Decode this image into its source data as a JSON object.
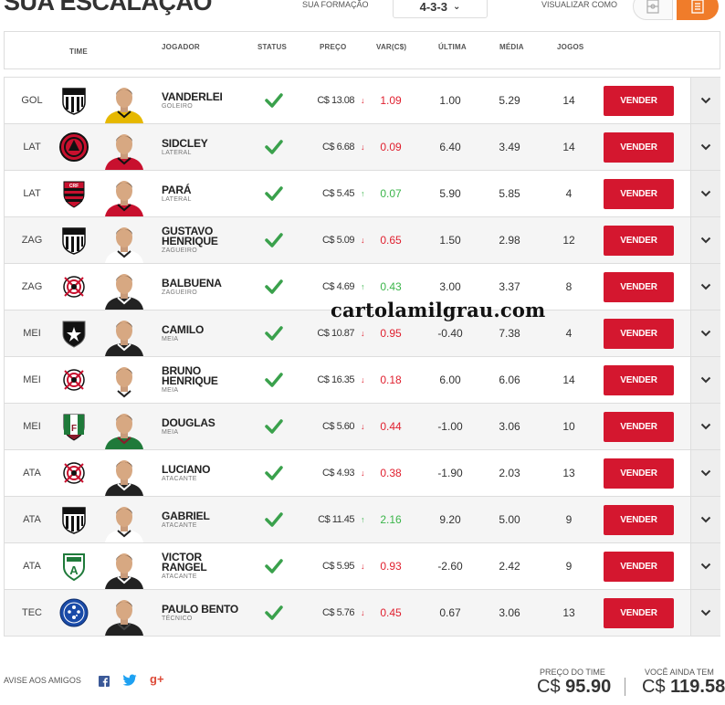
{
  "header": {
    "title": "SUA ESCALAÇÃO",
    "formation_label": "SUA FORMAÇÃO",
    "formation_value": "4-3-3",
    "view_label": "VISUALIZAR COMO"
  },
  "columns": {
    "time": "TIME",
    "jogador": "JOGADOR",
    "status": "STATUS",
    "preco": "PREÇO",
    "var": "VAR(C$)",
    "ultima": "ÚLTIMA",
    "media": "MÉDIA",
    "jogos": "JOGOS"
  },
  "colors": {
    "accent": "#f07c2a",
    "sell": "#d4172f",
    "down": "#e0202f",
    "up": "#3bb54a",
    "status_ok": "#3aa14c"
  },
  "players": [
    {
      "pos": "GOL",
      "team_icon": "santos-crest-icon",
      "name1": "VANDERLEI",
      "name2": "",
      "role": "GOLEIRO",
      "price": "C$ 13.08",
      "trend": "down",
      "var": "1.09",
      "ultima": "1.00",
      "media": "5.29",
      "jogos": "14",
      "sell": "VENDER",
      "kit": "#e6b800",
      "kit2": "#111"
    },
    {
      "pos": "LAT",
      "team_icon": "atletico-pr-crest-icon",
      "name1": "SIDCLEY",
      "name2": "",
      "role": "LATERAL",
      "price": "C$ 6.68",
      "trend": "down",
      "var": "0.09",
      "ultima": "6.40",
      "media": "3.49",
      "jogos": "14",
      "sell": "VENDER",
      "kit": "#c8102e",
      "kit2": "#111"
    },
    {
      "pos": "LAT",
      "team_icon": "flamengo-crest-icon",
      "name1": "PARÁ",
      "name2": "",
      "role": "LATERAL",
      "price": "C$ 5.45",
      "trend": "up",
      "var": "0.07",
      "ultima": "5.90",
      "media": "5.85",
      "jogos": "4",
      "sell": "VENDER",
      "kit": "#c8102e",
      "kit2": "#111"
    },
    {
      "pos": "ZAG",
      "team_icon": "santos-crest-icon",
      "name1": "GUSTAVO",
      "name2": "HENRIQUE",
      "role": "ZAGUEIRO",
      "price": "C$ 5.09",
      "trend": "down",
      "var": "0.65",
      "ultima": "1.50",
      "media": "2.98",
      "jogos": "12",
      "sell": "VENDER",
      "kit": "#ffffff",
      "kit2": "#222"
    },
    {
      "pos": "ZAG",
      "team_icon": "corinthians-crest-icon",
      "name1": "BALBUENA",
      "name2": "",
      "role": "ZAGUEIRO",
      "price": "C$ 4.69",
      "trend": "up",
      "var": "0.43",
      "ultima": "3.00",
      "media": "3.37",
      "jogos": "8",
      "sell": "VENDER",
      "kit": "#222222",
      "kit2": "#fff"
    },
    {
      "pos": "MEI",
      "team_icon": "botafogo-crest-icon",
      "name1": "CAMILO",
      "name2": "",
      "role": "MEIA",
      "price": "C$ 10.87",
      "trend": "down",
      "var": "0.95",
      "ultima": "-0.40",
      "media": "7.38",
      "jogos": "4",
      "sell": "VENDER",
      "kit": "#222222",
      "kit2": "#fff"
    },
    {
      "pos": "MEI",
      "team_icon": "corinthians-crest-icon",
      "name1": "BRUNO",
      "name2": "HENRIQUE",
      "role": "MEIA",
      "price": "C$ 16.35",
      "trend": "down",
      "var": "0.18",
      "ultima": "6.00",
      "media": "6.06",
      "jogos": "14",
      "sell": "VENDER",
      "kit": "#ffffff",
      "kit2": "#222"
    },
    {
      "pos": "MEI",
      "team_icon": "fluminense-crest-icon",
      "name1": "DOUGLAS",
      "name2": "",
      "role": "MEIA",
      "price": "C$ 5.60",
      "trend": "down",
      "var": "0.44",
      "ultima": "-1.00",
      "media": "3.06",
      "jogos": "10",
      "sell": "VENDER",
      "kit": "#1f7a3a",
      "kit2": "#8b1a2b"
    },
    {
      "pos": "ATA",
      "team_icon": "corinthians-crest-icon",
      "name1": "LUCIANO",
      "name2": "",
      "role": "ATACANTE",
      "price": "C$ 4.93",
      "trend": "down",
      "var": "0.38",
      "ultima": "-1.90",
      "media": "2.03",
      "jogos": "13",
      "sell": "VENDER",
      "kit": "#222222",
      "kit2": "#fff"
    },
    {
      "pos": "ATA",
      "team_icon": "santos-crest-icon",
      "name1": "GABRIEL",
      "name2": "",
      "role": "ATACANTE",
      "price": "C$ 11.45",
      "trend": "up",
      "var": "2.16",
      "ultima": "9.20",
      "media": "5.00",
      "jogos": "9",
      "sell": "VENDER",
      "kit": "#ffffff",
      "kit2": "#222"
    },
    {
      "pos": "ATA",
      "team_icon": "america-mg-crest-icon",
      "name1": "VICTOR",
      "name2": "RANGEL",
      "role": "ATACANTE",
      "price": "C$ 5.95",
      "trend": "down",
      "var": "0.93",
      "ultima": "-2.60",
      "media": "2.42",
      "jogos": "9",
      "sell": "VENDER",
      "kit": "#222222",
      "kit2": "#fff"
    },
    {
      "pos": "TEC",
      "team_icon": "cruzeiro-crest-icon",
      "name1": "PAULO BENTO",
      "name2": "",
      "role": "TÉCNICO",
      "price": "C$ 5.76",
      "trend": "down",
      "var": "0.45",
      "ultima": "0.67",
      "media": "3.06",
      "jogos": "13",
      "sell": "VENDER",
      "kit": "#222222",
      "kit2": "#444"
    }
  ],
  "watermark": "cartolamilgrau.com",
  "footer": {
    "share_label": "AVISE AOS AMIGOS",
    "team_price_label": "PREÇO DO TIME",
    "team_price_currency": "C$",
    "team_price_value": "95.90",
    "remaining_label": "VOCÊ AINDA TEM",
    "remaining_currency": "C$",
    "remaining_value": "119.58"
  }
}
